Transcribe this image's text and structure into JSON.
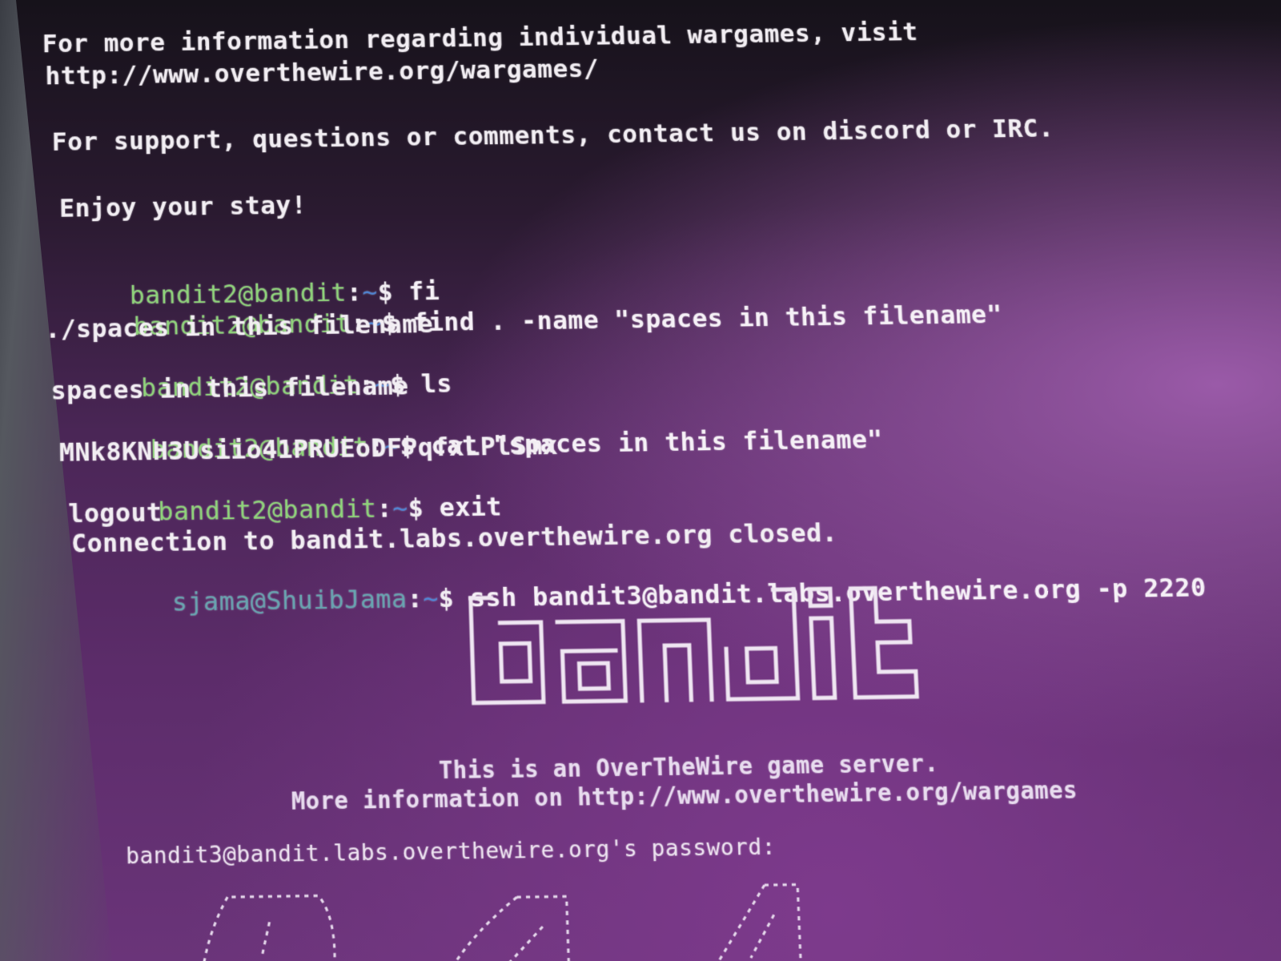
{
  "terminal": {
    "lines": {
      "info1": "For more information regarding individual wargames, visit",
      "info2": "http://www.overthewire.org/wargames/",
      "support": "For support, questions or comments, contact us on discord or IRC.",
      "enjoy": "Enjoy your stay!",
      "out_find": "./spaces in this filename",
      "out_ls": "spaces in this filename",
      "out_cat": "MNk8KNH3Usiio41PRUEoDFPqfxLPlSmx",
      "out_logout": "logout",
      "out_closed": "Connection to bandit.labs.overthewire.org closed."
    },
    "prompt": {
      "remote_user": "bandit2@bandit",
      "local_user": "sjama@ShuibJama",
      "path": "~",
      "symbol": "$"
    },
    "commands": {
      "c1": "fi",
      "c2": "find . -name \"spaces in this filename\"",
      "c3": "ls",
      "c4": "cat \"spaces in this filename\"",
      "c5": "exit",
      "c6": "ssh bandit3@bandit.labs.overthewire.org -p 2220"
    },
    "banner": {
      "motd1": "This is an OverTheWire game server.",
      "motd2": "More information on http://www.overthewire.org/wargames"
    },
    "password_prompt": "bandit3@bandit.labs.overthewire.org's password:"
  },
  "colors": {
    "user": "#8fd47a",
    "path": "#4e86d6",
    "background": "#5c2c6a"
  }
}
